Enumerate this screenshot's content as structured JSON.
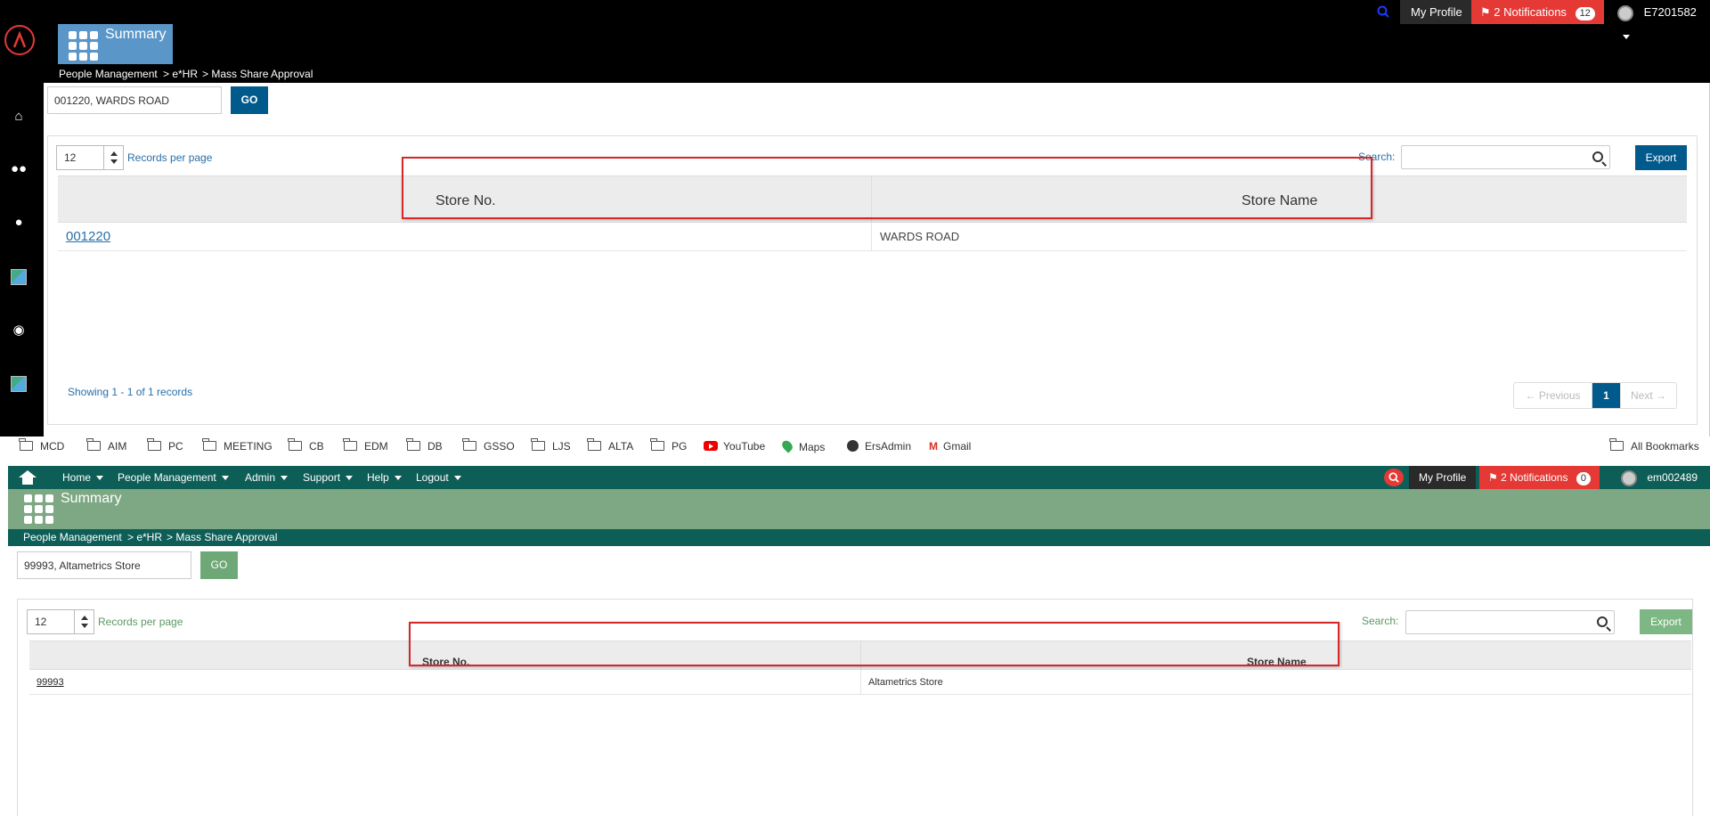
{
  "top": {
    "header": {
      "summary_label": "Summary",
      "my_profile": "My Profile",
      "notifications_label": "2 Notifications",
      "notifications_badge": "12",
      "user_id": "E7201582"
    },
    "breadcrumb": [
      "People Management",
      "> e*HR",
      "> Mass Share Approval"
    ],
    "store_input_value": "001220, WARDS ROAD",
    "go_label": "GO",
    "records_per_page_value": "12",
    "records_per_page_label": "Records per page",
    "search_label": "Search:",
    "export_label": "Export",
    "columns": [
      "Store No.",
      "Store Name"
    ],
    "rows": [
      {
        "store_no": "001220",
        "store_name": "WARDS ROAD"
      }
    ],
    "showing_text": "Showing 1 - 1 of 1 records",
    "pager": {
      "prev": "← Previous",
      "page": "1",
      "next": "Next →"
    },
    "colors": {
      "header_bg": "#000000",
      "accent": "#005a8c",
      "tile": "#5b96c8",
      "link": "#2a6fa8"
    }
  },
  "bookmarks": [
    {
      "label": "MCD",
      "icon": "folder-icon"
    },
    {
      "label": "AIM",
      "icon": "folder-icon"
    },
    {
      "label": "PC",
      "icon": "folder-icon"
    },
    {
      "label": "MEETING",
      "icon": "folder-icon"
    },
    {
      "label": "CB",
      "icon": "folder-icon"
    },
    {
      "label": "EDM",
      "icon": "folder-icon"
    },
    {
      "label": "DB",
      "icon": "folder-icon"
    },
    {
      "label": "GSSO",
      "icon": "folder-icon"
    },
    {
      "label": "LJS",
      "icon": "folder-icon"
    },
    {
      "label": "ALTA",
      "icon": "folder-icon"
    },
    {
      "label": "PG",
      "icon": "folder-icon"
    },
    {
      "label": "YouTube",
      "icon": "youtube-icon"
    },
    {
      "label": "Maps",
      "icon": "maps-icon"
    },
    {
      "label": "ErsAdmin",
      "icon": "globe-icon"
    },
    {
      "label": "Gmail",
      "icon": "gmail-icon"
    }
  ],
  "all_bookmarks": "All Bookmarks",
  "bottom": {
    "nav": [
      "Home",
      "People Management",
      "Admin",
      "Support",
      "Help",
      "Logout"
    ],
    "header": {
      "my_profile": "My Profile",
      "notifications_label": "2 Notifications",
      "notifications_badge": "0",
      "user_id": "em002489"
    },
    "summary_label": "Summary",
    "breadcrumb": [
      "People Management",
      "> e*HR",
      "> Mass Share Approval"
    ],
    "store_input_value": "99993, Altametrics Store",
    "go_label": "GO",
    "records_per_page_value": "12",
    "records_per_page_label": "Records per page",
    "search_label": "Search:",
    "export_label": "Export",
    "columns": [
      "Store No.",
      "Store Name"
    ],
    "rows": [
      {
        "store_no": "99993",
        "store_name": "Altametrics Store"
      }
    ],
    "colors": {
      "nav_bg": "#0e5e58",
      "band": "#7da883",
      "accent": "#6fa877",
      "label": "#5a9a62"
    }
  }
}
